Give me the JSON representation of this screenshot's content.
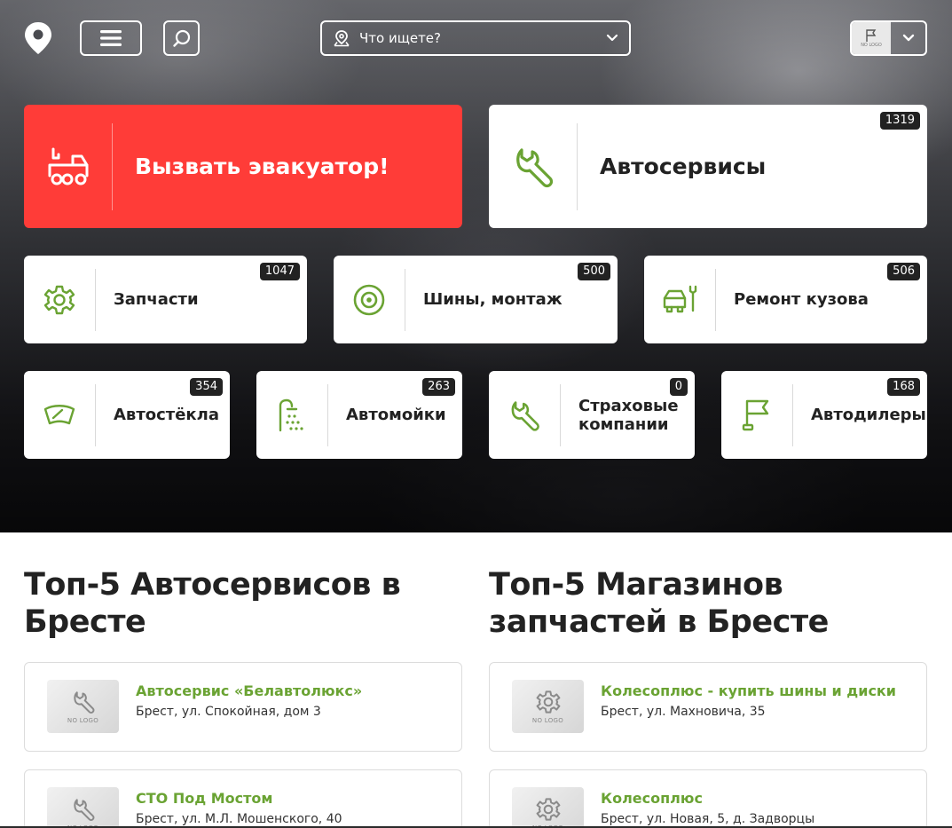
{
  "header": {
    "search_placeholder": "Что ищете?",
    "city_logo_text": "NO LOGO"
  },
  "tiles": {
    "tow": {
      "label": "Вызвать эвакуатор!"
    },
    "autoservices": {
      "label": "Автосервисы",
      "count": "1319"
    },
    "parts": {
      "label": "Запчасти",
      "count": "1047"
    },
    "tires": {
      "label": "Шины, монтаж",
      "count": "500"
    },
    "body_repair": {
      "label": "Ремонт кузова",
      "count": "506"
    },
    "glass": {
      "label": "Автостёкла",
      "count": "354"
    },
    "carwash": {
      "label": "Автомойки",
      "count": "263"
    },
    "insurance": {
      "label": "Страховые компании",
      "count": "0"
    },
    "dealers": {
      "label": "Автодилеры",
      "count": "168"
    }
  },
  "top_services": {
    "title": "Топ-5 Автосервисов в Бресте",
    "items": [
      {
        "name": "Автосервис «Белавтолюкс»",
        "address": "Брест, ул. Спокойная, дом 3"
      },
      {
        "name": "СТО Под Мостом",
        "address": "Брест, ул. М.Л. Мошенского, 40"
      }
    ]
  },
  "top_parts": {
    "title": "Топ-5 Магазинов запчастей в Бресте",
    "items": [
      {
        "name": "Колесоплюс - купить шины и диски",
        "address": "Брест, ул. Махновича, 35"
      },
      {
        "name": "Колесоплюс",
        "address": "Брест, ул. Новая, 5, д. Задворцы"
      }
    ]
  },
  "no_logo_text": "NO LOGO",
  "colors": {
    "accent_green": "#6aa333",
    "accent_red": "#ff3c38",
    "badge_dark": "#222222"
  }
}
